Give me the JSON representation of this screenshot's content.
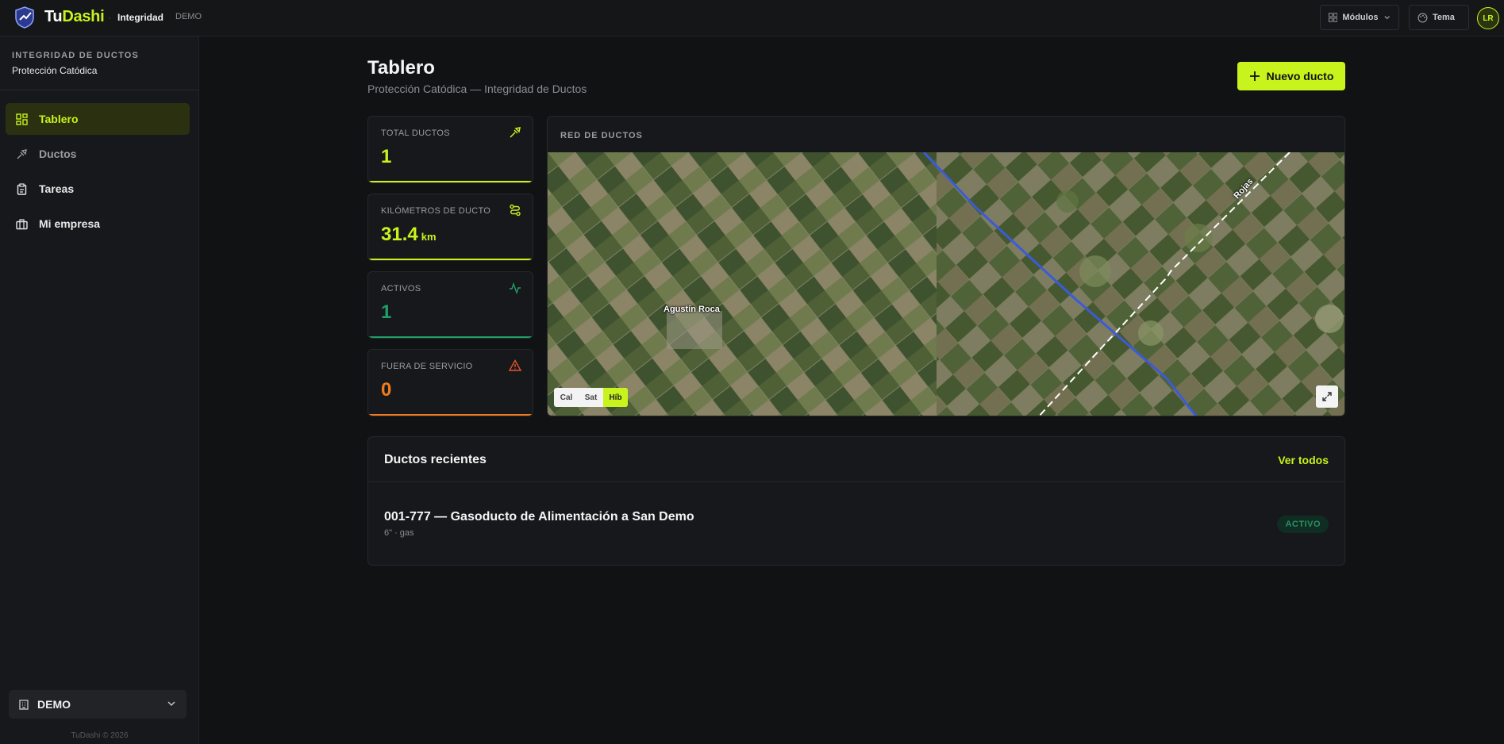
{
  "header": {
    "brand_tu": "Tu",
    "brand_dashi": "Dashi",
    "separator": "·",
    "module": "Integridad",
    "mode": "DEMO",
    "modules_button": "Módulos",
    "theme_button": "Tema",
    "avatar_initials": "LR"
  },
  "sidebar": {
    "section_label": "INTEGRIDAD DE DUCTOS",
    "section_sub": "Protección Catódica",
    "items": [
      {
        "label": "Tablero",
        "icon": "dashboard-grid-icon",
        "active": true
      },
      {
        "label": "Ductos",
        "icon": "pipe-icon",
        "active": false
      },
      {
        "label": "Tareas",
        "icon": "clipboard-icon",
        "active": false
      },
      {
        "label": "Mi empresa",
        "icon": "briefcase-icon",
        "active": false
      }
    ],
    "tenant": "DEMO",
    "copyright": "TuDashi © 2026"
  },
  "page": {
    "title": "Tablero",
    "subtitle": "Protección Catódica — Integridad de Ductos",
    "new_button": "Nuevo ducto"
  },
  "stats": [
    {
      "label": "TOTAL DUCTOS",
      "value": "1",
      "unit": "",
      "color": "#c8f31d",
      "icon": "pipe-icon"
    },
    {
      "label": "KILÓMETROS DE DUCTO",
      "value": "31.4",
      "unit": "km",
      "color": "#c8f31d",
      "icon": "route-icon"
    },
    {
      "label": "ACTIVOS",
      "value": "1",
      "unit": "",
      "color": "#1f9e68",
      "icon": "activity-icon"
    },
    {
      "label": "FUERA DE SERVICIO",
      "value": "0",
      "unit": "",
      "color": "#f07b1e",
      "icon": "warning-icon"
    }
  ],
  "map": {
    "title": "RED DE DUCTOS",
    "place_label": "Agustín Roca",
    "road_label": "Rojas",
    "layers": [
      "Cal",
      "Sat",
      "Híb"
    ],
    "active_layer": "Híb"
  },
  "recent": {
    "title": "Ductos recientes",
    "see_all": "Ver todos",
    "items": [
      {
        "title": "001-777 — Gasoducto de Alimentación a San Demo",
        "meta": "6\" · gas",
        "status": "ACTIVO"
      }
    ]
  }
}
